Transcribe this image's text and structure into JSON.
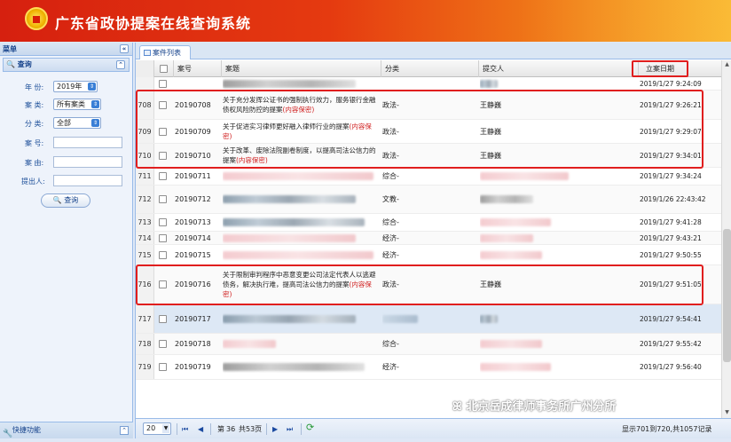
{
  "header": {
    "title": "广东省政协提案在线查询系统"
  },
  "sidebar": {
    "title": "菜单",
    "collapse_glyph": "«",
    "section": "查询",
    "section_collapse_glyph": "⌃",
    "fields": {
      "year_label": "年  份:",
      "year_value": "2019年",
      "type_label": "案  类:",
      "type_value": "所有案类",
      "category_label": "分  类:",
      "category_value": "全部",
      "number_label": "案  号:",
      "subject_label": "案  由:",
      "proposer_label": "提出人:"
    },
    "query_button": "查询",
    "quick_label": "快捷功能"
  },
  "tab": {
    "label": "案件列表"
  },
  "grid": {
    "headers": {
      "no": "案号",
      "title": "案题",
      "category": "分类",
      "submitter": "提交人",
      "date": "立案日期"
    },
    "rows": [
      {
        "idx": "",
        "no": "",
        "title": "",
        "category": "",
        "submitter": "",
        "date": "2019/1/27 9:24:09"
      },
      {
        "idx": "708",
        "no": "20190708",
        "title": "关于充分发挥公证书的强制执行效力，服务银行金融债权风险防控的提案",
        "secret": "(内容保密)",
        "category": "政法-",
        "submitter": "王静巍",
        "date": "2019/1/27 9:26:21"
      },
      {
        "idx": "709",
        "no": "20190709",
        "title": "关于促进实习律师更好融入律师行业的提案",
        "secret": "(内容保密)",
        "category": "政法-",
        "submitter": "王静巍",
        "date": "2019/1/27 9:29:07"
      },
      {
        "idx": "710",
        "no": "20190710",
        "title": "关于改革、废除法院副卷制度，以提高司法公信力的提案",
        "secret": "(内容保密)",
        "category": "政法-",
        "submitter": "王静巍",
        "date": "2019/1/27 9:34:01"
      },
      {
        "idx": "711",
        "no": "20190711",
        "title": "",
        "category": "综合-",
        "submitter": "",
        "date": "2019/1/27 9:34:24"
      },
      {
        "idx": "712",
        "no": "20190712",
        "title": "",
        "category": "文教-",
        "submitter": "",
        "date": "2019/1/26 22:43:42"
      },
      {
        "idx": "713",
        "no": "20190713",
        "title": "",
        "category": "综合-",
        "submitter": "",
        "date": "2019/1/27 9:41:28"
      },
      {
        "idx": "714",
        "no": "20190714",
        "title": "",
        "category": "经济-",
        "submitter": "",
        "date": "2019/1/27 9:43:21"
      },
      {
        "idx": "715",
        "no": "20190715",
        "title": "",
        "category": "经济-",
        "submitter": "",
        "date": "2019/1/27 9:50:55"
      },
      {
        "idx": "716",
        "no": "20190716",
        "title": "关于限制审判程序中恶意变更公司法定代表人以逃避债务，解决执行难，提高司法公信力的提案",
        "secret": "(内容保密)",
        "category": "政法-",
        "submitter": "王静巍",
        "date": "2019/1/27 9:51:05"
      },
      {
        "idx": "717",
        "no": "20190717",
        "title": "",
        "category": "",
        "submitter": "",
        "date": "2019/1/27 9:54:41"
      },
      {
        "idx": "718",
        "no": "20190718",
        "title": "",
        "category": "综合-",
        "submitter": "",
        "date": "2019/1/27 9:55:42"
      },
      {
        "idx": "719",
        "no": "20190719",
        "title": "",
        "category": "经济-",
        "submitter": "",
        "date": "2019/1/27 9:56:40"
      }
    ]
  },
  "pager": {
    "page_size": "20",
    "page_prefix": "第",
    "current_page": "36",
    "page_suffix": "共53页",
    "summary": "显示701到720,共1057记录",
    "first": "⏮",
    "prev": "◀",
    "next": "▶",
    "last": "⏭",
    "refresh": "⟳"
  },
  "watermark": {
    "icon": "ꕤ",
    "text": "北京岳成律师事务所广州分所"
  },
  "colors": {
    "header_start": "#d6200f",
    "header_end": "#f8b020",
    "highlight": "#e01e1e",
    "secret_text": "#d02020"
  }
}
